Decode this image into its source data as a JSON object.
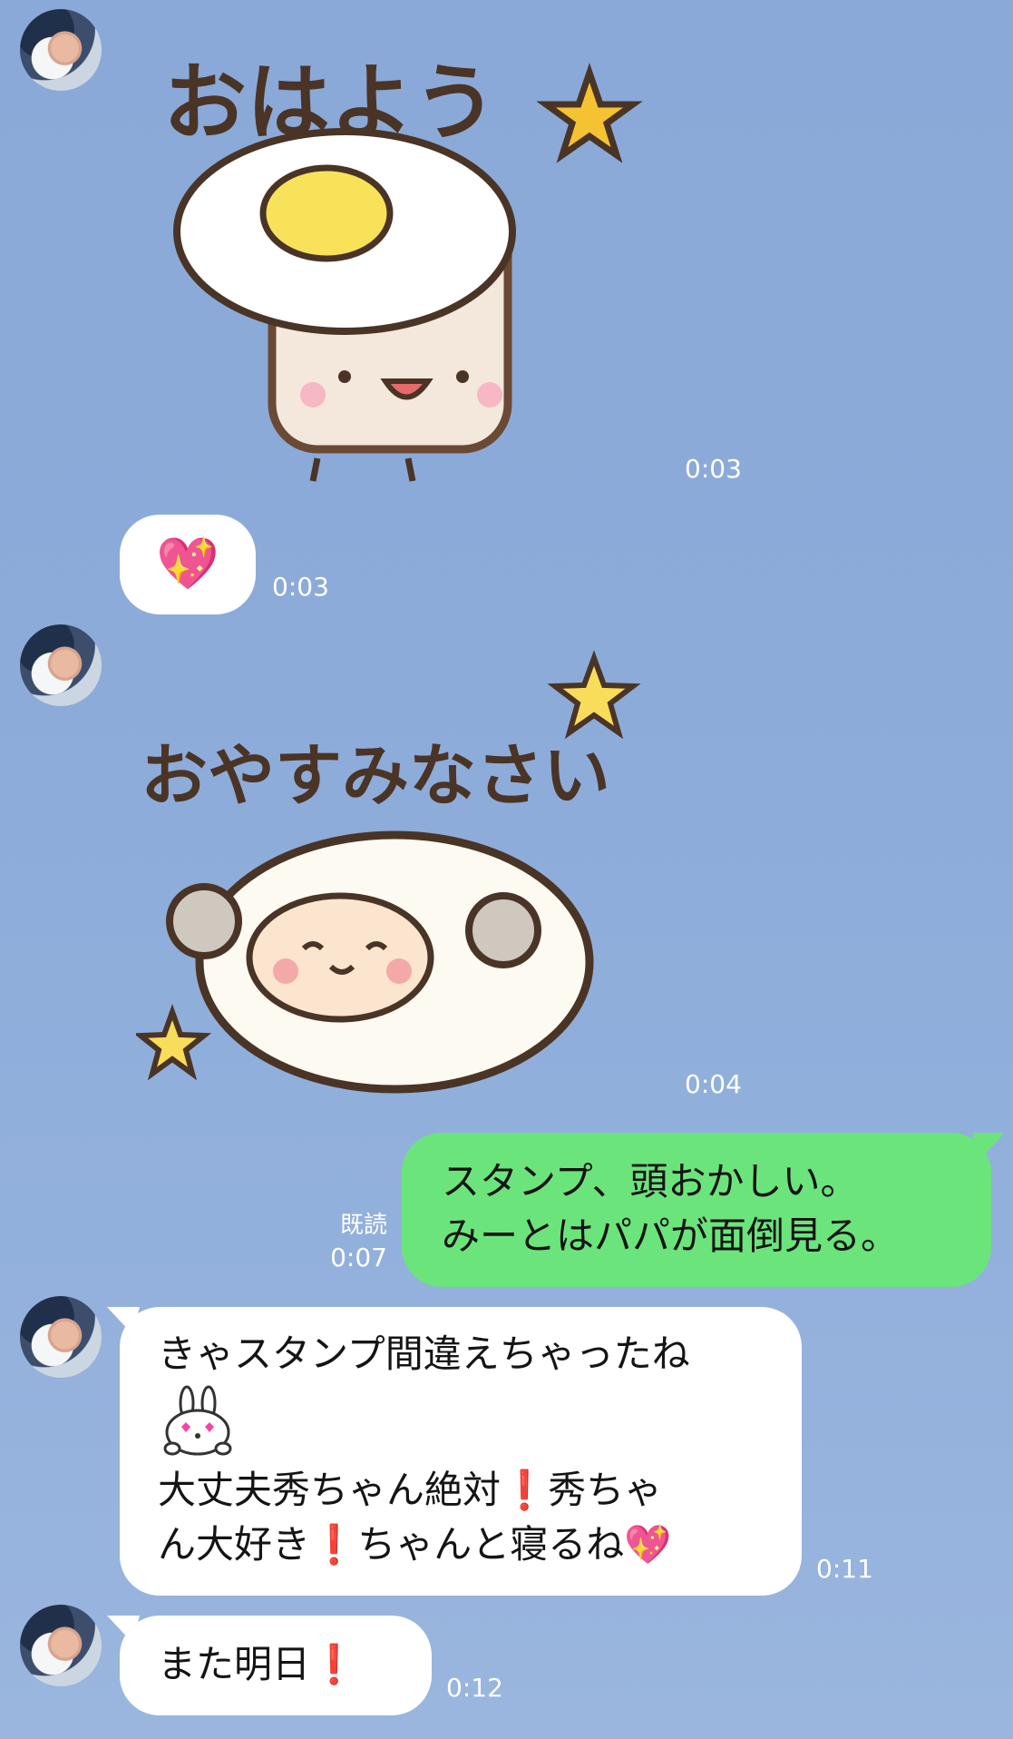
{
  "messages": [
    {
      "sticker_text": "おはよう",
      "time": "0:03"
    },
    {
      "emoji": "💖",
      "time": "0:03"
    },
    {
      "sticker_text": "おやすみなさい",
      "time": "0:04"
    },
    {
      "read_label": "既読",
      "time": "0:07",
      "lines": [
        "スタンプ、頭おかしい。",
        "みーとはパパが面倒見る。"
      ]
    },
    {
      "time": "0:11",
      "lines": [
        "きゃスタンプ間違えちゃったね",
        "大丈夫秀ちゃん絶対❗️秀ちゃ",
        "ん大好き❗️ちゃんと寝るね💖"
      ]
    },
    {
      "time": "0:12",
      "lines": [
        "また明日❗️"
      ]
    }
  ],
  "colors": {
    "background": "#8dabd9",
    "sent_bubble": "#6ce47c",
    "received_bubble": "#ffffff"
  }
}
